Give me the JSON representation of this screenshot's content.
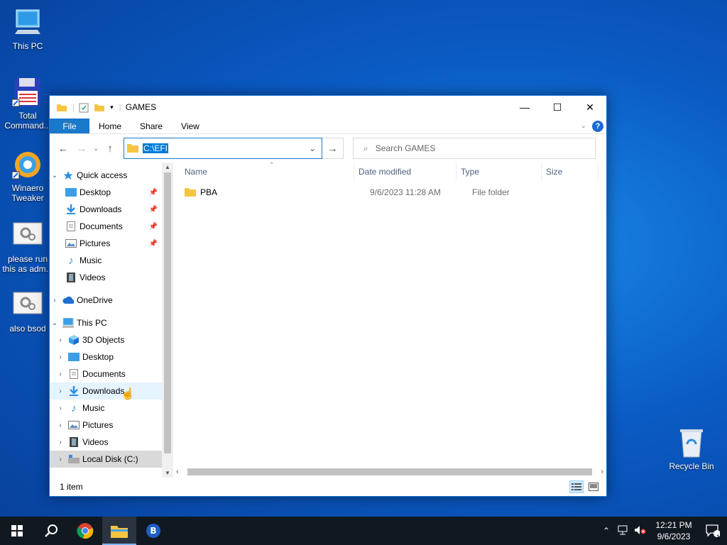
{
  "desktop": {
    "icons": [
      {
        "label": "This PC"
      },
      {
        "label": "Total\nCommand..."
      },
      {
        "label": "Winaero\nTweaker"
      },
      {
        "label": "please run\nthis as adm..."
      },
      {
        "label": "also bsod"
      },
      {
        "label": "Recycle Bin"
      }
    ]
  },
  "window": {
    "title": "GAMES",
    "controls": {
      "minimize": "—",
      "maximize": "☐",
      "close": "✕"
    },
    "ribbon_tabs": [
      "File",
      "Home",
      "Share",
      "View"
    ],
    "help": "?",
    "address": {
      "value": "C:\\EFI"
    },
    "search": {
      "placeholder": "Search GAMES"
    },
    "nav_pane": {
      "quick_access": "Quick access",
      "quick_items": [
        "Desktop",
        "Downloads",
        "Documents",
        "Pictures",
        "Music",
        "Videos"
      ],
      "onedrive": "OneDrive",
      "this_pc": "This PC",
      "pc_items": [
        "3D Objects",
        "Desktop",
        "Documents",
        "Downloads",
        "Music",
        "Pictures",
        "Videos",
        "Local Disk (C:)"
      ]
    },
    "columns": [
      "Name",
      "Date modified",
      "Type",
      "Size"
    ],
    "files": [
      {
        "name": "PBA",
        "date": "9/6/2023 11:28 AM",
        "type": "File folder",
        "size": ""
      }
    ],
    "status": "1 item"
  },
  "taskbar": {
    "clock_time": "12:21 PM",
    "clock_date": "9/6/2023",
    "notification_count": "1"
  },
  "colors": {
    "accent": "#1979ca",
    "folder": "#f5c542",
    "taskbar": "#101820"
  }
}
